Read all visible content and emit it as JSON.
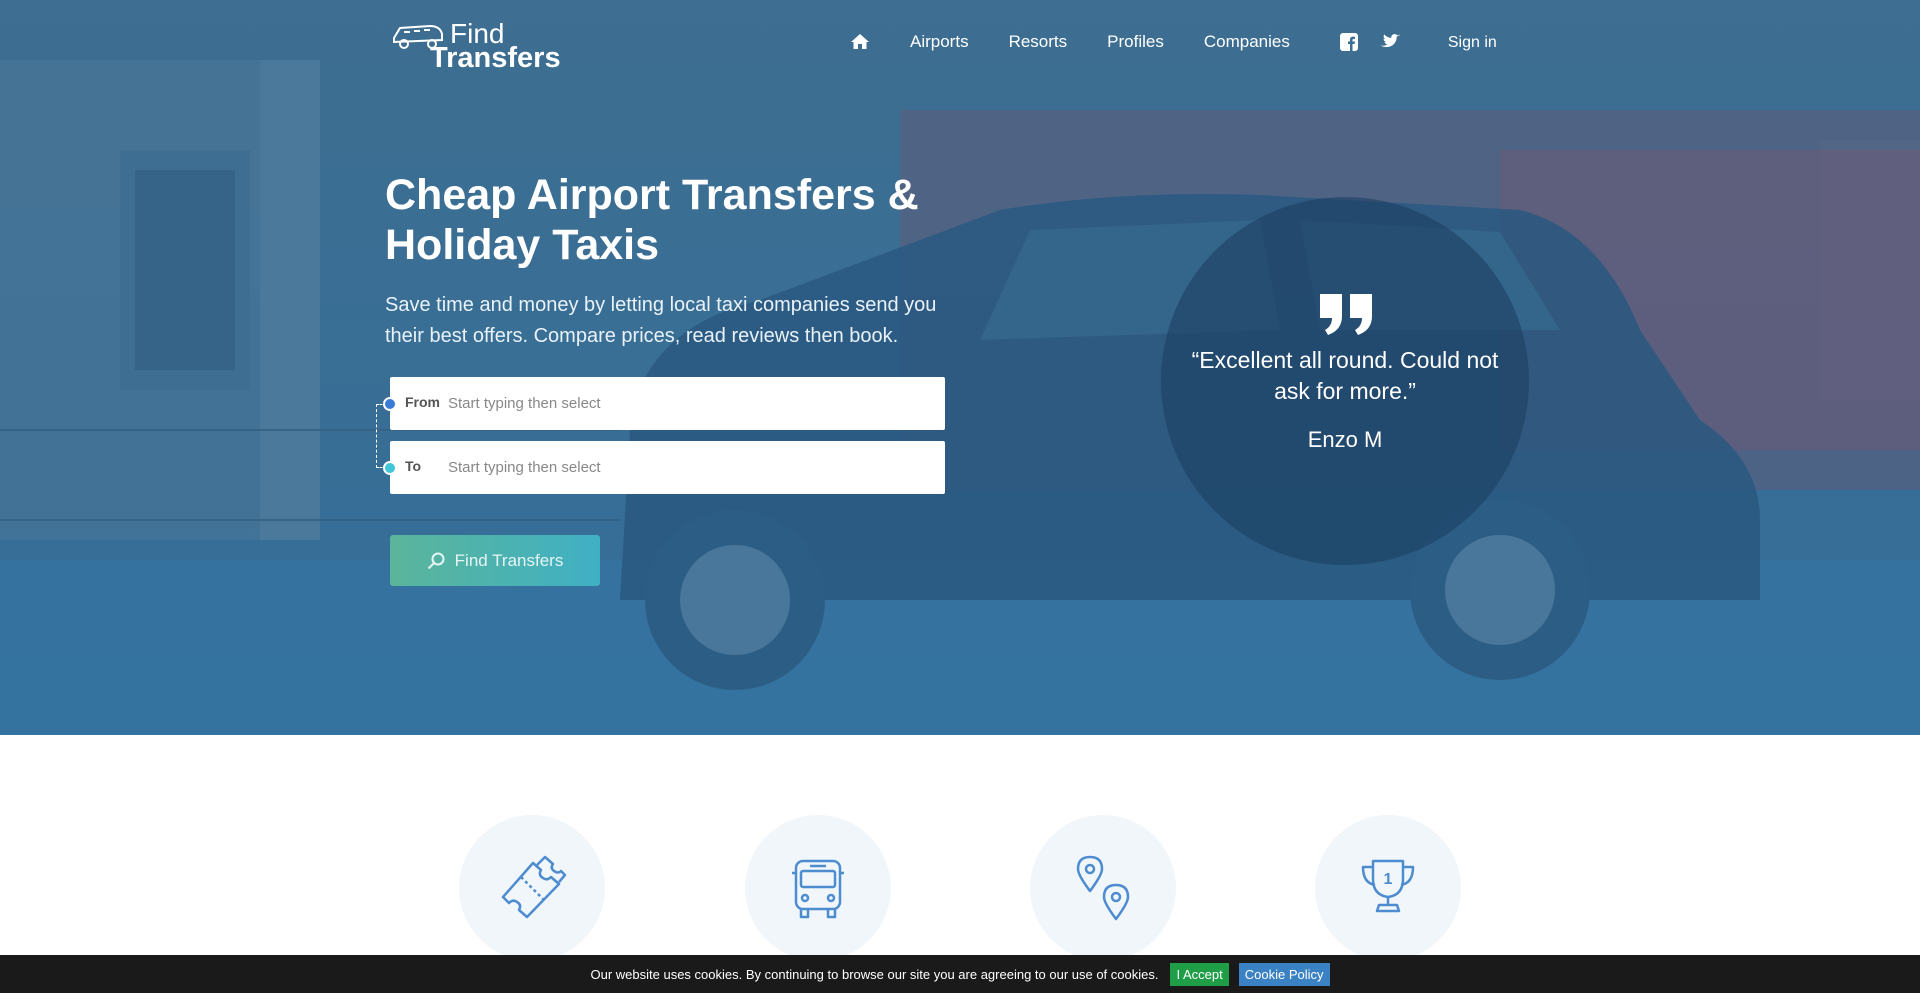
{
  "brand": {
    "logo_line1": "Find",
    "logo_line2": "Transfers"
  },
  "nav": {
    "home_icon": "home-icon",
    "links": [
      "Airports",
      "Resorts",
      "Profiles",
      "Companies"
    ],
    "social_icons": [
      "facebook-icon",
      "twitter-icon"
    ],
    "signin": "Sign in"
  },
  "hero": {
    "title": "Cheap Airport Transfers & Holiday Taxis",
    "subtitle": "Save time and money by letting local taxi companies send you their best offers. Compare prices, read reviews then book."
  },
  "search": {
    "from_label": "From",
    "from_placeholder": "Start typing then select",
    "to_label": "To",
    "to_placeholder": "Start typing then select",
    "button_label": "Find Transfers",
    "button_icon": "search-icon"
  },
  "testimonial": {
    "quote": "“Excellent all round. Could not ask for more.”",
    "author": "Enzo M"
  },
  "features": [
    {
      "icon": "ticket-icon"
    },
    {
      "icon": "bus-icon"
    },
    {
      "icon": "map-pins-icon"
    },
    {
      "icon": "trophy-icon"
    }
  ],
  "cookie": {
    "text": "Our website uses cookies. By continuing to browse our site you are agreeing to our use of cookies.",
    "accept_label": "I Accept",
    "policy_label": "Cookie Policy"
  },
  "colors": {
    "hero_overlay": "#3b7099",
    "accent_blue": "#3a7bd5",
    "accent_teal": "#41c5d8",
    "cookie_accept": "#1f9d47",
    "cookie_policy": "#3b82c4"
  }
}
